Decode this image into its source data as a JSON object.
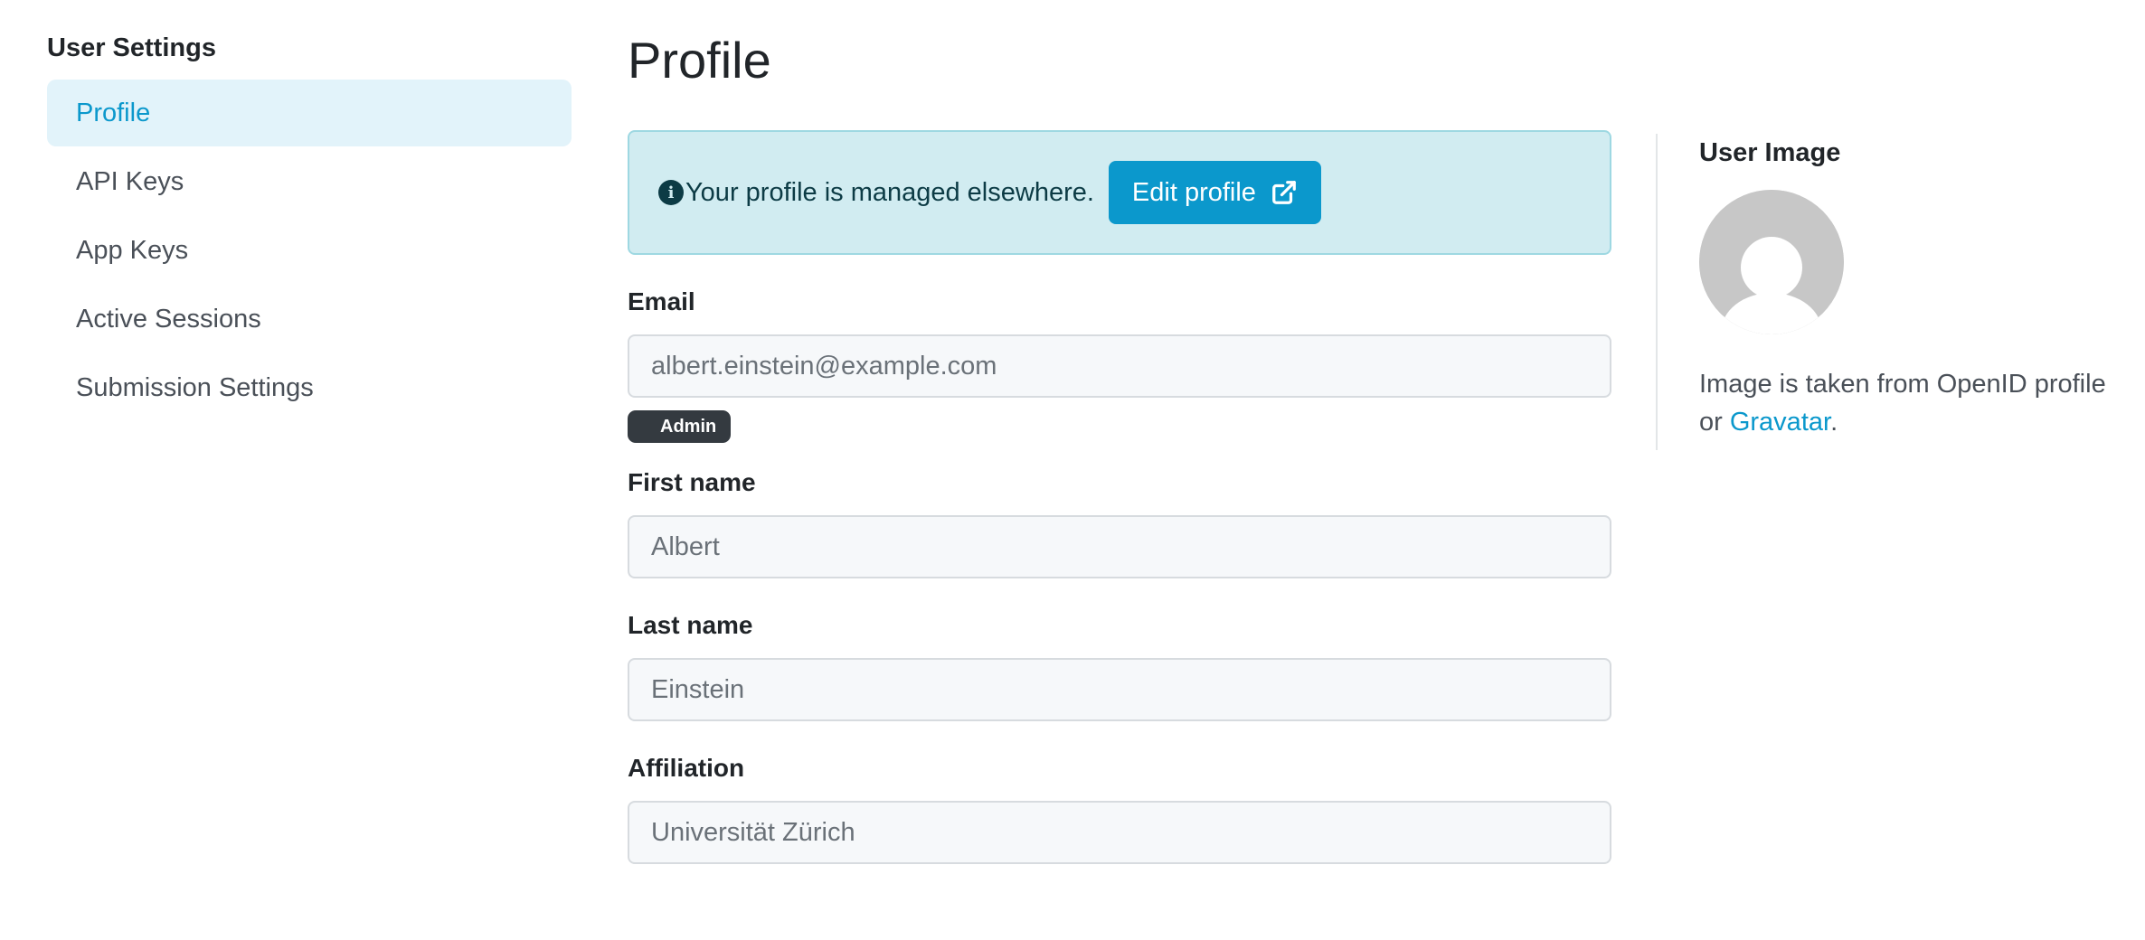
{
  "sidebar": {
    "title": "User Settings",
    "items": [
      {
        "label": "Profile",
        "active": true
      },
      {
        "label": "API Keys"
      },
      {
        "label": "App Keys"
      },
      {
        "label": "Active Sessions"
      },
      {
        "label": "Submission Settings"
      }
    ]
  },
  "main": {
    "title": "Profile",
    "alert": {
      "text": "Your profile is managed elsewhere.",
      "button_label": "Edit profile",
      "icon": "info-circle-icon",
      "button_icon": "external-link-icon"
    },
    "fields": {
      "email": {
        "label": "Email",
        "value": "albert.einstein@example.com"
      },
      "first_name": {
        "label": "First name",
        "value": "Albert"
      },
      "last_name": {
        "label": "Last name",
        "value": "Einstein"
      },
      "affiliation": {
        "label": "Affiliation",
        "value": "Universität Zürich"
      }
    },
    "badge": "Admin"
  },
  "user_image": {
    "title": "User Image",
    "text_before": "Image is taken from OpenID profile or ",
    "link_label": "Gravatar",
    "text_after": "."
  },
  "colors": {
    "accent": "#0b98cc",
    "active_bg": "#e2f3fa",
    "alert_bg": "#d1ecf1",
    "badge_bg": "#343a40"
  }
}
